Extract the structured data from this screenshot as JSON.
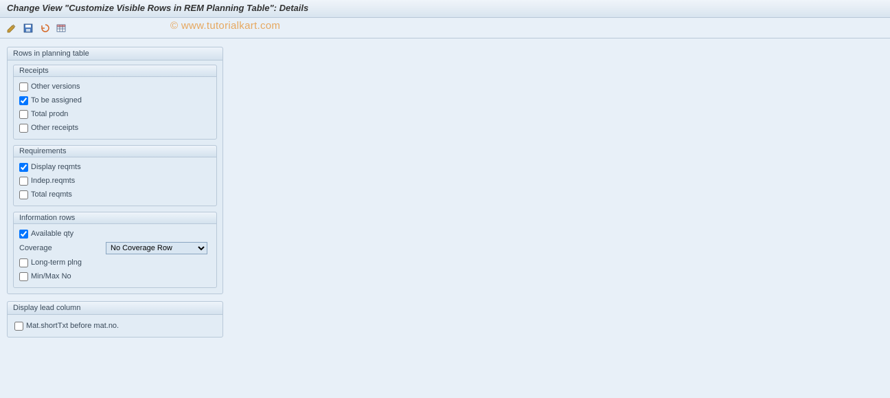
{
  "title": "Change View \"Customize Visible Rows in REM Planning Table\": Details",
  "watermark": "© www.tutorialkart.com",
  "toolbar": {
    "icons": [
      "edit-icon",
      "save-icon",
      "undo-icon",
      "table-settings-icon"
    ]
  },
  "panels": {
    "rows_planning": {
      "title": "Rows in planning table",
      "sub": {
        "receipts": {
          "title": "Receipts",
          "items": {
            "other_versions": {
              "label": "Other versions",
              "checked": false
            },
            "to_be_assigned": {
              "label": "To be assigned",
              "checked": true
            },
            "total_prodn": {
              "label": "Total prodn",
              "checked": false
            },
            "other_receipts": {
              "label": "Other receipts",
              "checked": false
            }
          }
        },
        "requirements": {
          "title": "Requirements",
          "items": {
            "display_reqmts": {
              "label": "Display reqmts",
              "checked": true
            },
            "indep_reqmts": {
              "label": "Indep.reqmts",
              "checked": false
            },
            "total_reqmts": {
              "label": "Total reqmts",
              "checked": false
            }
          }
        },
        "information_rows": {
          "title": "Information rows",
          "items": {
            "available_qty": {
              "label": "Available qty",
              "checked": true
            },
            "coverage": {
              "label": "Coverage",
              "value": "No Coverage Row"
            },
            "long_term_plng": {
              "label": "Long-term plng",
              "checked": false
            },
            "min_max_no": {
              "label": "Min/Max No",
              "checked": false
            }
          }
        }
      }
    },
    "display_lead_column": {
      "title": "Display lead column",
      "items": {
        "mat_shorttxt": {
          "label": "Mat.shortTxt before mat.no.",
          "checked": false
        }
      }
    }
  }
}
